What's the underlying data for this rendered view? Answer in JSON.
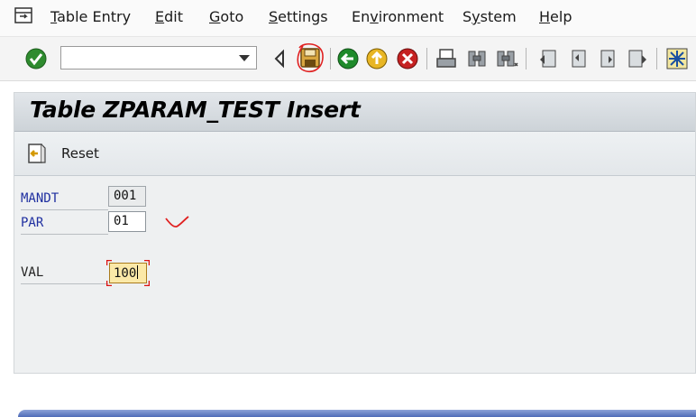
{
  "menu": {
    "items": [
      {
        "mnemonic": "T",
        "rest": "able Entry"
      },
      {
        "mnemonic": "E",
        "rest": "dit"
      },
      {
        "mnemonic": "G",
        "rest": "oto"
      },
      {
        "mnemonic": "S",
        "rest": "ettings"
      },
      {
        "pre": "En",
        "mnemonic": "v",
        "rest": "ironment"
      },
      {
        "pre": "S",
        "mnemonic": "y",
        "rest": "stem"
      },
      {
        "mnemonic": "H",
        "rest": "elp"
      }
    ]
  },
  "toolbar": {
    "command_field_value": "",
    "icons": [
      "enter-check-icon",
      "back-triangle-icon",
      "save-icon",
      "back-arrow-icon",
      "exit-icon",
      "cancel-icon",
      "print-icon",
      "find-icon",
      "find-next-icon",
      "first-page-icon",
      "previous-page-icon",
      "next-page-icon",
      "last-page-icon",
      "customize-layout-icon"
    ],
    "annotation_color": "#e02020"
  },
  "page": {
    "title": "Table ZPARAM_TEST Insert"
  },
  "app_toolbar": {
    "reset_label": "Reset"
  },
  "form": {
    "fields": [
      {
        "label": "MANDT",
        "value": "001",
        "type": "key",
        "state": "readonly"
      },
      {
        "label": "PAR",
        "value": "01",
        "type": "key",
        "state": "editable"
      },
      {
        "label": "VAL",
        "value": "100",
        "type": "plain",
        "state": "focused"
      }
    ],
    "focus_color": "#fbe9a8"
  }
}
